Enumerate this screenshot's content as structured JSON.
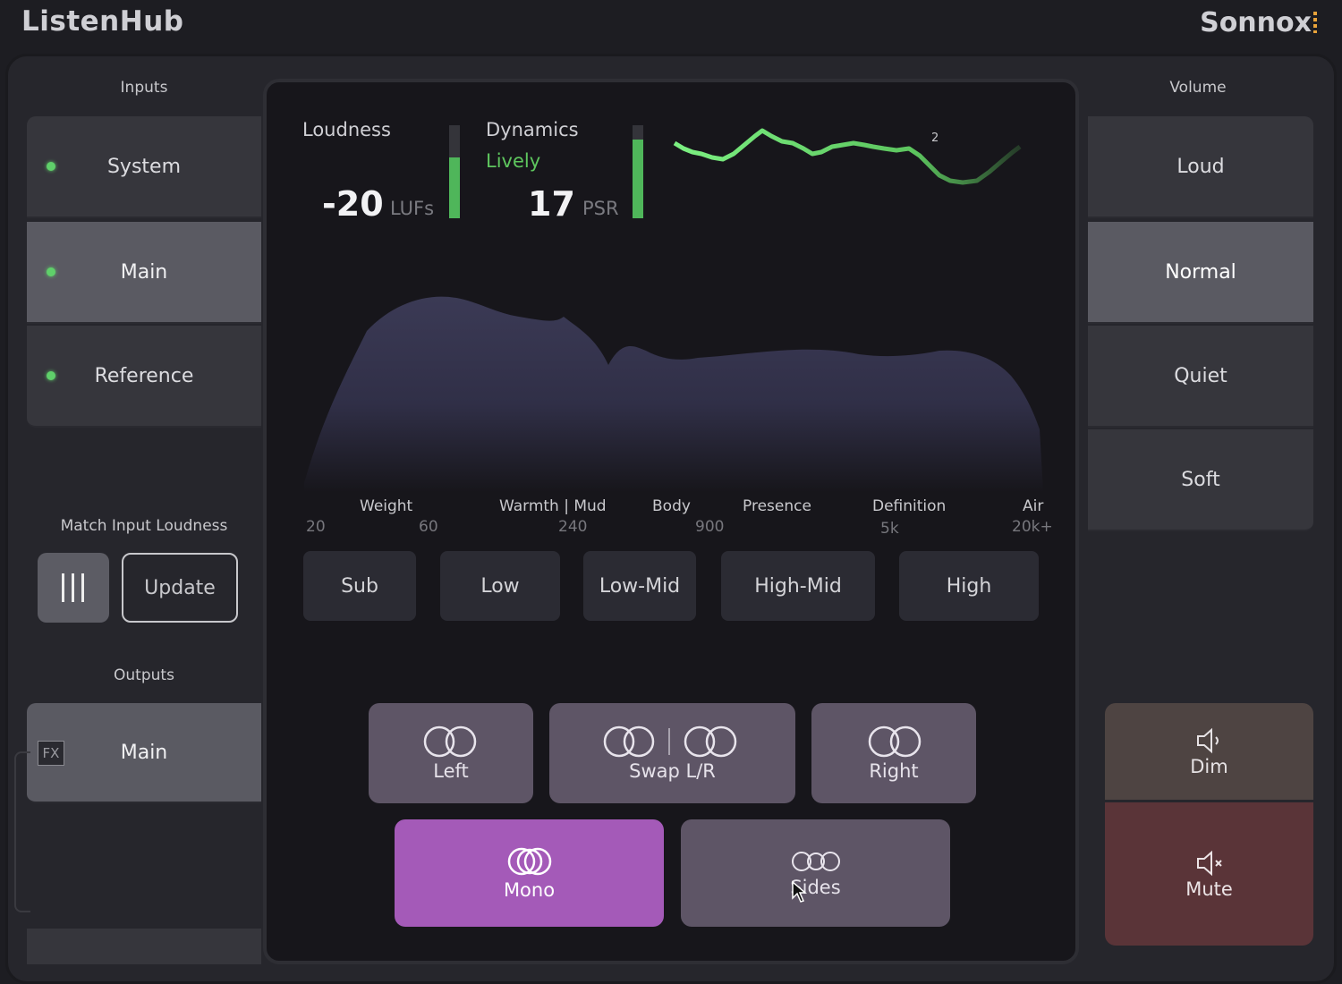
{
  "app": {
    "title": "ListenHub",
    "brand": "Sonnox"
  },
  "inputs": {
    "label": "Inputs",
    "items": [
      {
        "label": "System",
        "selected": false
      },
      {
        "label": "Main",
        "selected": true
      },
      {
        "label": "Reference",
        "selected": false
      }
    ]
  },
  "match": {
    "label": "Match Input Loudness",
    "update_label": "Update"
  },
  "outputs": {
    "label": "Outputs",
    "fx_label": "FX",
    "main_label": "Main"
  },
  "meters": {
    "loudness_label": "Loudness",
    "loudness_value": "-20",
    "loudness_unit": "LUFs",
    "dynamics_label": "Dynamics",
    "dynamics_state": "Lively",
    "dynamics_value": "17",
    "dynamics_unit": "PSR",
    "history_marker": "2"
  },
  "spectrum": {
    "labels": [
      "Weight",
      "Warmth | Mud",
      "Body",
      "Presence",
      "Definition",
      "Air"
    ],
    "freqs": [
      "20",
      "60",
      "240",
      "900",
      "5k",
      "20k+"
    ]
  },
  "bands": [
    "Sub",
    "Low",
    "Low-Mid",
    "High-Mid",
    "High"
  ],
  "monitor": {
    "left": "Left",
    "swap": "Swap L/R",
    "right": "Right",
    "mono": "Mono",
    "sides": "Sides"
  },
  "volume": {
    "label": "Volume",
    "items": [
      {
        "label": "Loud",
        "selected": false
      },
      {
        "label": "Normal",
        "selected": true
      },
      {
        "label": "Quiet",
        "selected": false
      },
      {
        "label": "Soft",
        "selected": false
      }
    ],
    "dim": "Dim",
    "mute": "Mute"
  },
  "colors": {
    "accent_green": "#6ee87a",
    "mono_active": "#a45ab8",
    "mute": "#5a3438",
    "dim": "#4e4442"
  }
}
